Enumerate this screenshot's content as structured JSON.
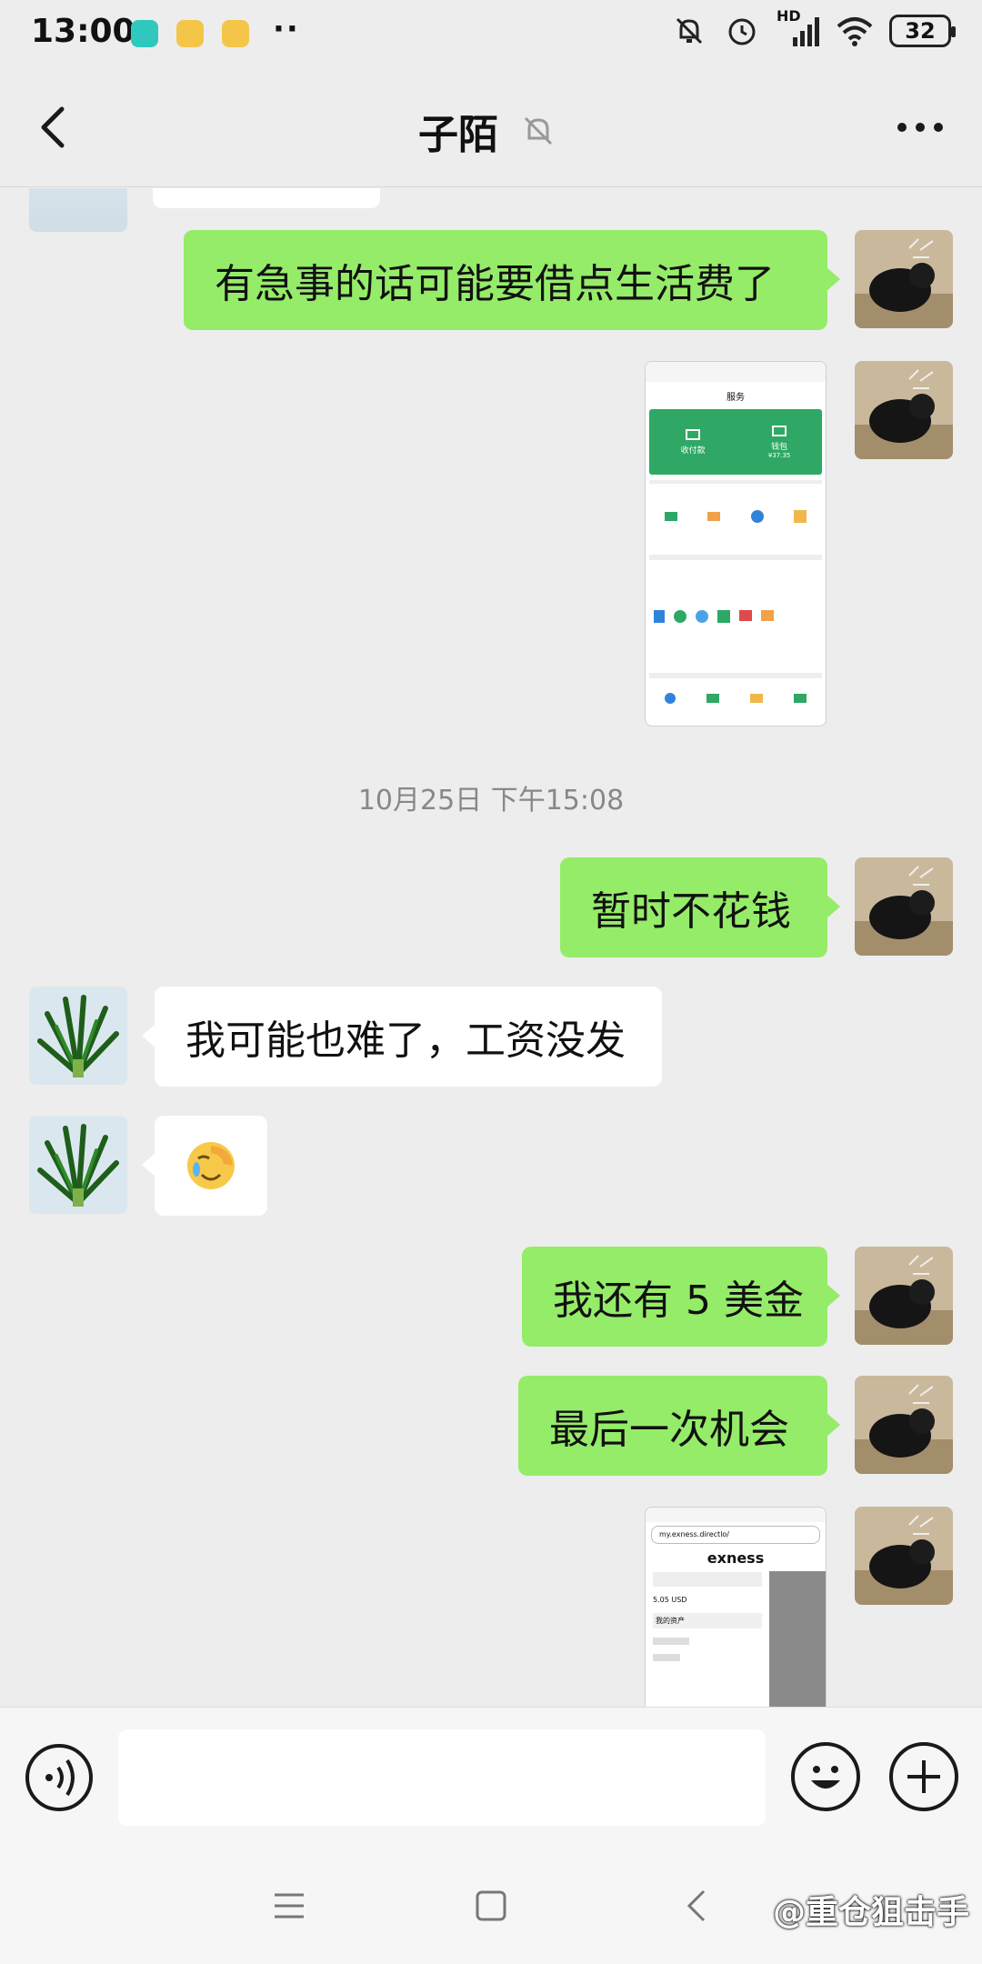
{
  "status_bar": {
    "time": "13:00",
    "battery": "32",
    "network": "HD"
  },
  "header": {
    "title": "子陌"
  },
  "messages": [
    {
      "side": "right",
      "text": "有急事的话可能要借点生活费了"
    },
    {
      "side": "right",
      "type": "image"
    },
    {
      "timestamp": "10月25日 下午15:08"
    },
    {
      "side": "right",
      "text": "暂时不花钱"
    },
    {
      "side": "left",
      "text": "我可能也难了，工资没发"
    },
    {
      "side": "left",
      "type": "emoji",
      "emoji": "😭"
    },
    {
      "side": "right",
      "text": "我还有 5 美金"
    },
    {
      "side": "right",
      "text": "最后一次机会"
    },
    {
      "side": "right",
      "type": "image"
    }
  ],
  "wallet_shot": {
    "title": "服务",
    "pay_label": "收付款",
    "wallet_label": "钱包",
    "wallet_amount": "¥37.35"
  },
  "exness_shot": {
    "url": "my.exness.directlo/",
    "brand": "exness",
    "balance": "5.05 USD",
    "item": "我的资产"
  },
  "watermark": "@重仓狙击手",
  "colors": {
    "bubble_green": "#95ec69",
    "background": "#ededed",
    "wechat_green": "#07c160"
  }
}
